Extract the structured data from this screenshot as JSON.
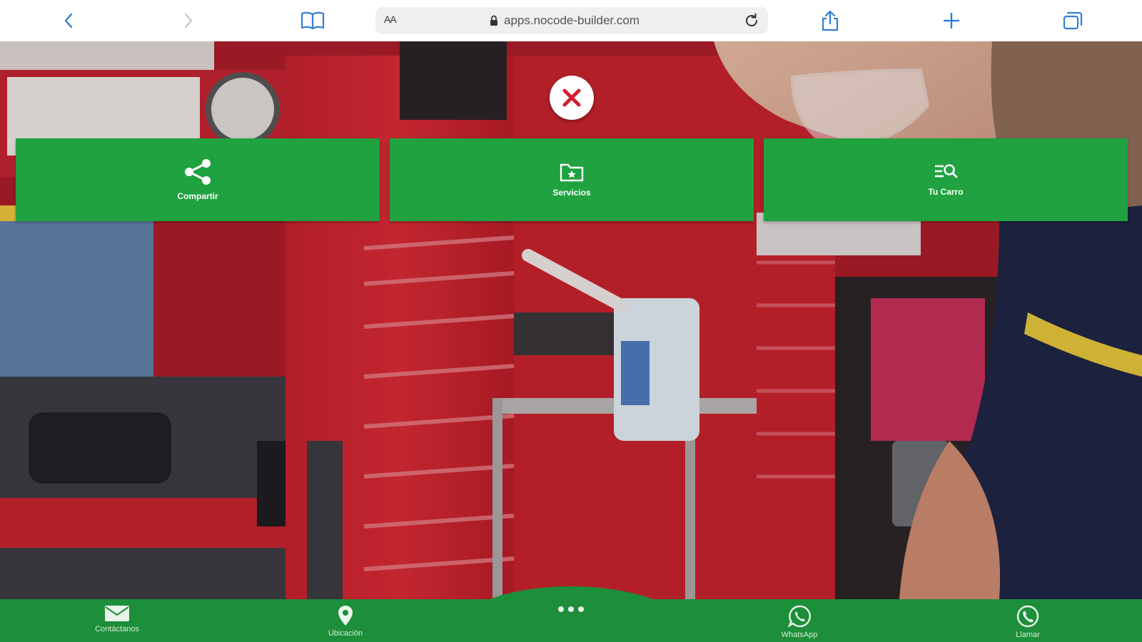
{
  "browser": {
    "address_bar": {
      "text_size_label": "AA",
      "url": "apps.nocode-builder.com"
    }
  },
  "overlay": {
    "actions": [
      {
        "label": "Compartir",
        "icon": "share-icon"
      },
      {
        "label": "Servicios",
        "icon": "folder-icon"
      },
      {
        "label": "Tu Carro",
        "icon": "search-list-icon"
      }
    ]
  },
  "bottom_nav": {
    "items": [
      {
        "label": "Contáctanos",
        "icon": "mail-icon"
      },
      {
        "label": "Ubicación",
        "icon": "location-pin-icon"
      },
      {
        "label": "WhatsApp",
        "icon": "whatsapp-icon"
      },
      {
        "label": "Llamar",
        "icon": "phone-icon"
      }
    ]
  },
  "colors": {
    "accent_green": "#1fa23f",
    "nav_green": "#1d8e3a",
    "toolbar_icon_blue": "#2f7fd6"
  }
}
